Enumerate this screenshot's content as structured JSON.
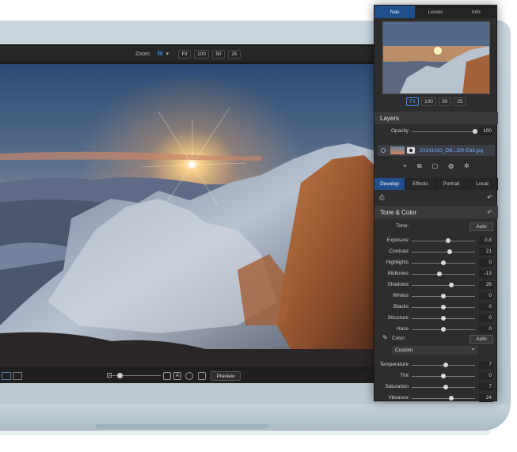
{
  "toolbar": {
    "zoom_label": "Zoom",
    "zoom_current": "fit",
    "zoom_options": [
      "Fit",
      "100",
      "50",
      "25"
    ]
  },
  "bottom_bar": {
    "preview_label": "Preview"
  },
  "panel": {
    "tabs": [
      "Nav",
      "Levels",
      "Info"
    ],
    "active_tab": "Nav",
    "nav_zoom": [
      "Fit",
      "100",
      "50",
      "25"
    ],
    "layers": {
      "title": "Layers",
      "opacity_label": "Opacity",
      "opacity_value": "100",
      "opacity_level": 1.0,
      "layer_name": "20141020_DB...DR-Edit.jpg"
    },
    "develop_tabs": [
      "Develop",
      "Effects",
      "Portrait",
      "Local"
    ],
    "tone_color": {
      "title": "Tone & Color",
      "tone_label": "Tone:",
      "auto_label": "Auto",
      "sliders": [
        {
          "label": "Exposure",
          "value": "0.8",
          "level": 0.58
        },
        {
          "label": "Contrast",
          "value": "21",
          "level": 0.6
        },
        {
          "label": "Highlights",
          "value": "0",
          "level": 0.5
        },
        {
          "label": "Midtones",
          "value": "-13",
          "level": 0.44
        },
        {
          "label": "Shadows",
          "value": "26",
          "level": 0.63
        },
        {
          "label": "Whites",
          "value": "0",
          "level": 0.5
        },
        {
          "label": "Blacks",
          "value": "0",
          "level": 0.5
        },
        {
          "label": "Structure",
          "value": "0",
          "level": 0.5
        },
        {
          "label": "Haze",
          "value": "0",
          "level": 0.5
        }
      ],
      "color_label": "Color:",
      "color_auto_label": "Auto",
      "custom_label": "Custom",
      "color_sliders": [
        {
          "label": "Temperature",
          "value": "7",
          "level": 0.54
        },
        {
          "label": "Tint",
          "value": "0",
          "level": 0.5
        },
        {
          "label": "Saturation",
          "value": "7",
          "level": 0.54
        },
        {
          "label": "Vibrance",
          "value": "24",
          "level": 0.62
        }
      ]
    }
  },
  "colors": {
    "accent": "#1e4f8a",
    "link": "#6aa9ff",
    "panel_bg": "#2d2d2d"
  },
  "icons": [
    "eye-icon",
    "add-layer-icon",
    "duplicate-icon",
    "mask-icon",
    "adjust-icon",
    "settings-icon",
    "reset-icon",
    "brush-icon",
    "chevron-down-icon"
  ]
}
